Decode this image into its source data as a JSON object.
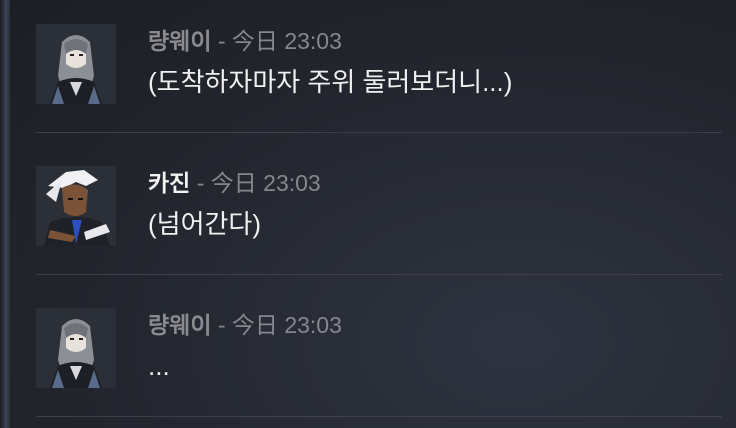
{
  "messages": [
    {
      "author": "량웨이",
      "timestamp": "- 今日 23:03",
      "text": "(도착하자마자 주위 둘러보더니...)",
      "avatar": "long-haired-character-portrait"
    },
    {
      "author": "카진",
      "timestamp": "- 今日 23:03",
      "text": "(넘어간다)",
      "avatar": "white-haired-character-portrait"
    },
    {
      "author": "량웨이",
      "timestamp": "- 今日 23:03",
      "text": "...",
      "avatar": "long-haired-character-portrait"
    }
  ],
  "colors": {
    "background": "#23262e",
    "author_muted": "#8b8b8f",
    "author_bright": "#f2f2f2",
    "timestamp": "#85878c",
    "divider": "#3d4048"
  }
}
